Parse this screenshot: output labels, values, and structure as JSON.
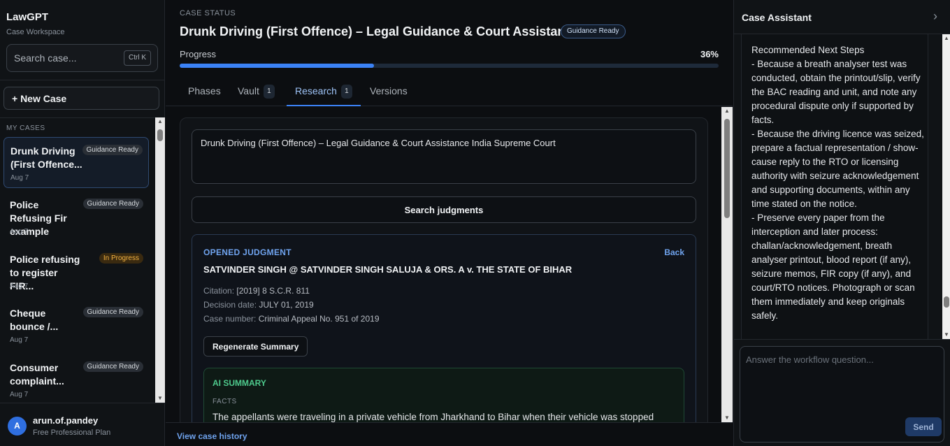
{
  "sidebar": {
    "brand": "LawGPT",
    "brand_sub": "Case Workspace",
    "search_placeholder": "Search case...",
    "search_shortcut": "Ctrl K",
    "new_case_label": "+ New Case",
    "section_label": "MY CASES",
    "cases": [
      {
        "title": "Drunk Driving (First Offence...",
        "badge": "Guidance Ready",
        "date": "Aug 7",
        "active": true
      },
      {
        "title": "Police Refusing Fir example",
        "badge": "Guidance Ready",
        "date": "Aug 7"
      },
      {
        "title": "Police refusing to register FIR...",
        "badge": "In Progress",
        "date": "Aug 7"
      },
      {
        "title": "Cheque bounce /...",
        "badge": "Guidance Ready",
        "date": "Aug 7"
      },
      {
        "title": "Consumer complaint...",
        "badge": "Guidance Ready",
        "date": "Aug 7"
      }
    ],
    "user": {
      "initial": "A",
      "name": "arun.of.pandey",
      "plan": "Free Professional Plan"
    }
  },
  "main": {
    "status_label": "CASE STATUS",
    "title": "Drunk Driving (First Offence) – Legal Guidance & Court Assistance",
    "title_badge": "Guidance Ready",
    "progress_label": "Progress",
    "progress_text": "36%",
    "progress_value": 0.36,
    "tabs": [
      {
        "label": "Phases",
        "count": ""
      },
      {
        "label": "Vault",
        "count": "1"
      },
      {
        "label": "Research",
        "count": "1",
        "active": true
      },
      {
        "label": "Versions",
        "count": ""
      }
    ],
    "research": {
      "query": "Drunk Driving (First Offence) – Legal Guidance & Court Assistance India Supreme Court",
      "search_button": "Search judgments",
      "judgment": {
        "section_label": "OPENED JUDGMENT",
        "back_label": "Back",
        "title": "SATVINDER SINGH @ SATVINDER SINGH SALUJA & ORS. A v. THE STATE OF BIHAR",
        "citation_label": "Citation:",
        "citation": "[2019] 8 S.C.R. 811",
        "decision_label": "Decision date:",
        "decision_date": "JULY 01, 2019",
        "case_number_label": "Case number:",
        "case_number": "Criminal Appeal No. 951 of 2019",
        "regenerate_label": "Regenerate Summary",
        "ai_summary_label": "AI SUMMARY",
        "facts_label": "FACTS",
        "facts_text": "The appellants were traveling in a private vehicle from Jharkhand to Bihar when their vehicle was stopped"
      }
    },
    "view_history": "View case history"
  },
  "assistant": {
    "title": "Case Assistant",
    "message": "Recommended Next Steps\n- Because a breath analyser test was conducted, obtain the printout/slip, verify the BAC reading and unit, and note any procedural dispute only if supported by facts.\n- Because the driving licence was seized, prepare a factual representation / show-cause reply to the RTO or licensing authority with seizure acknowledgement and supporting documents, within any time stated on the notice.\n- Preserve every paper from the interception and later process: challan/acknowledgement, breath analyser printout, blood report (if any), seizure memos, FIR copy (if any), and court/RTO notices. Photograph or scan them immediately and keep originals safely.",
    "input_placeholder": "Answer the workflow question...",
    "send_label": "Send"
  },
  "colors": {
    "accent": "#3b82f6",
    "warning": "#f5b341",
    "success": "#4ec98c"
  }
}
